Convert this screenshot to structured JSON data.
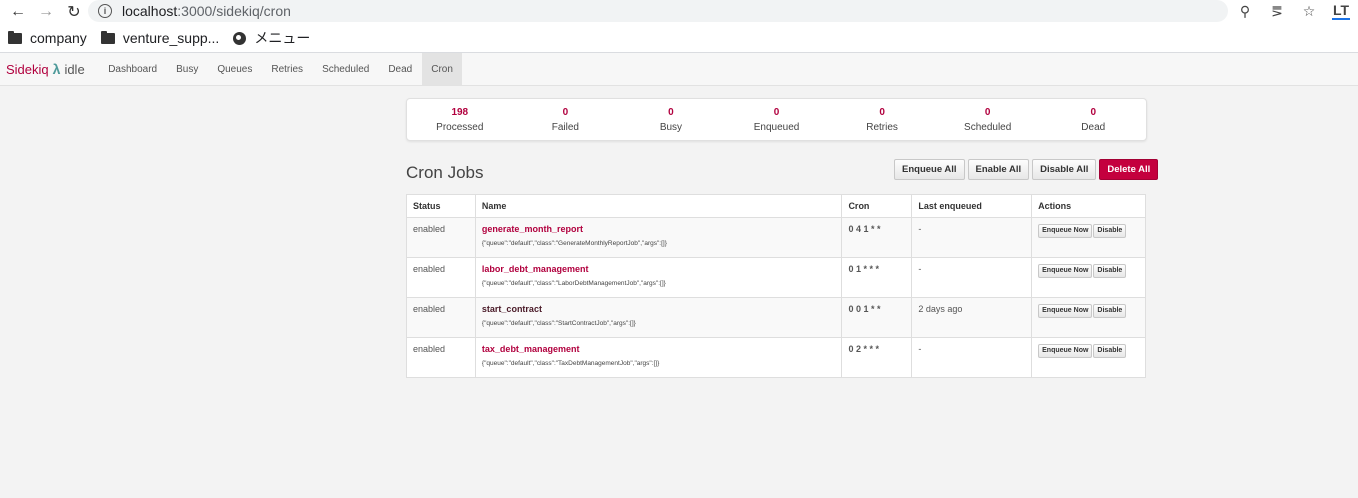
{
  "browser": {
    "url_host": "localhost",
    "url_path": ":3000/sidekiq/cron",
    "profile_badge": "LT"
  },
  "bookmarks": [
    {
      "label": "company",
      "icon": "folder-icon"
    },
    {
      "label": "venture_supp...",
      "icon": "folder-icon"
    },
    {
      "label": "メニュー",
      "icon": "globe-icon"
    }
  ],
  "nav": {
    "brand": "Sidekiq",
    "status": "idle",
    "links": [
      "Dashboard",
      "Busy",
      "Queues",
      "Retries",
      "Scheduled",
      "Dead",
      "Cron"
    ],
    "active": "Cron"
  },
  "summary": [
    {
      "count": "198",
      "label": "Processed"
    },
    {
      "count": "0",
      "label": "Failed"
    },
    {
      "count": "0",
      "label": "Busy"
    },
    {
      "count": "0",
      "label": "Enqueued"
    },
    {
      "count": "0",
      "label": "Retries"
    },
    {
      "count": "0",
      "label": "Scheduled"
    },
    {
      "count": "0",
      "label": "Dead"
    }
  ],
  "cron": {
    "title": "Cron Jobs",
    "buttons": {
      "enqueue_all": "Enqueue All",
      "enable_all": "Enable All",
      "disable_all": "Disable All",
      "delete_all": "Delete All"
    },
    "columns": [
      "Status",
      "Name",
      "Cron",
      "Last enqueued",
      "Actions"
    ],
    "rows": [
      {
        "status": "enabled",
        "name": "generate_month_report",
        "args": "{\"queue\":\"default\",\"class\":\"GenerateMonthlyReportJob\",\"args\":[]}",
        "cron": "0 4 1 * *",
        "last_enqueued": "-",
        "enqueue_now": "Enqueue Now",
        "disable": "Disable"
      },
      {
        "status": "enabled",
        "name": "labor_debt_management",
        "args": "{\"queue\":\"default\",\"class\":\"LaborDebtManagementJob\",\"args\":[]}",
        "cron": "0 1 * * *",
        "last_enqueued": "-",
        "enqueue_now": "Enqueue Now",
        "disable": "Disable"
      },
      {
        "status": "enabled",
        "name": "start_contract",
        "args": "{\"queue\":\"default\",\"class\":\"StartContractJob\",\"args\":[]}",
        "cron": "0 0 1 * *",
        "last_enqueued": "2 days ago",
        "enqueue_now": "Enqueue Now",
        "disable": "Disable"
      },
      {
        "status": "enabled",
        "name": "tax_debt_management",
        "args": "{\"queue\":\"default\",\"class\":\"TaxDebtManagementJob\",\"args\":[]}",
        "cron": "0 2 * * *",
        "last_enqueued": "-",
        "enqueue_now": "Enqueue Now",
        "disable": "Disable"
      }
    ]
  }
}
